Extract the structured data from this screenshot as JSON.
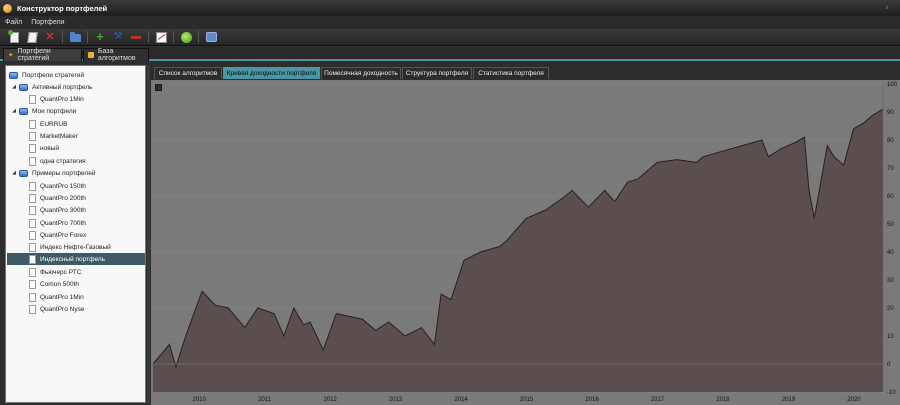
{
  "window": {
    "title": "Конструктор портфелей"
  },
  "menu": [
    "Файл",
    "Портфели"
  ],
  "toolbar_icons": [
    "new-document-icon",
    "edit-document-icon",
    "delete-icon",
    "open-folder-icon",
    "add-icon",
    "settings-icon",
    "remove-icon",
    "chart-icon",
    "refresh-icon",
    "database-icon"
  ],
  "doc_tabs": [
    {
      "label": "Портфели стратегий",
      "icon": "star-icon",
      "active": true
    },
    {
      "label": "База алгоритмов",
      "icon": "database-icon",
      "active": false
    }
  ],
  "tree": {
    "root": {
      "label": "Портфели стратегий"
    },
    "groups": [
      {
        "label": "Активный портфель",
        "items": [
          "QuantPro 1Min"
        ]
      },
      {
        "label": "Мои портфели",
        "items": [
          "EURRUB",
          "MarketMaker",
          "новый",
          "одна стратегия"
        ]
      },
      {
        "label": "Примеры портфелей",
        "items": [
          "QuantPro 150th",
          "QuantPro 200th",
          "QuantPro 300th",
          "QuantPro 700th",
          "QuantPro Forex",
          "Индекс Нефте-Газовый",
          "Индексный портфель",
          "Фьючерс РТС",
          "Comon 500th",
          "QuantPro 1Min",
          "QuantPro Nyse"
        ]
      }
    ],
    "selected": "Индексный портфель"
  },
  "sub_tabs": [
    {
      "label": "Список алгоритмов",
      "active": false
    },
    {
      "label": "Кривая доходности портфеля",
      "active": true
    },
    {
      "label": "Помесячная доходность",
      "active": false
    },
    {
      "label": "Структура портфеля",
      "active": false
    },
    {
      "label": "Статистика портфеля",
      "active": false
    }
  ],
  "colors": {
    "accent": "#4b96a6",
    "chart_background": "#7a7a7a",
    "area_fill": "#5a4e4e",
    "area_line": "#2a1e1e",
    "selection": "#405a65"
  },
  "chart_data": {
    "type": "area",
    "x": [
      2009.6,
      2009.85,
      2009.95,
      2010.1,
      2010.35,
      2010.55,
      2010.75,
      2011.0,
      2011.2,
      2011.45,
      2011.6,
      2011.75,
      2011.9,
      2012.0,
      2012.2,
      2012.4,
      2012.6,
      2012.8,
      2013.0,
      2013.2,
      2013.45,
      2013.7,
      2013.9,
      2014.0,
      2014.15,
      2014.35,
      2014.6,
      2014.9,
      2015.0,
      2015.3,
      2015.6,
      2015.9,
      2016.0,
      2016.25,
      2016.5,
      2016.65,
      2016.85,
      2017.0,
      2017.3,
      2017.6,
      2017.9,
      2018.0,
      2018.3,
      2018.6,
      2018.9,
      2019.0,
      2019.2,
      2019.4,
      2019.55,
      2019.62,
      2019.7,
      2019.9,
      2020.0,
      2020.15,
      2020.3,
      2020.45,
      2020.6,
      2020.75
    ],
    "values": [
      0,
      7,
      -1,
      10,
      26,
      21,
      20,
      13,
      20,
      18,
      10,
      20,
      14,
      15,
      5,
      18,
      17,
      16,
      12,
      15,
      10,
      13,
      7,
      25,
      23,
      37,
      40,
      42,
      44,
      52,
      55,
      60,
      62,
      56,
      62,
      58,
      65,
      66,
      72,
      73,
      72,
      74,
      76,
      78,
      80,
      74,
      77,
      79,
      81,
      62,
      52,
      78,
      74,
      71,
      84,
      86,
      89,
      91
    ],
    "xlim": [
      2009.6,
      2020.75
    ],
    "ylim": [
      -10,
      100
    ],
    "yticks": [
      100,
      90,
      80,
      70,
      60,
      50,
      40,
      30,
      20,
      10,
      0,
      -10
    ],
    "xtick_labels": [
      "2010",
      "2011",
      "2012",
      "2013",
      "2014",
      "2015",
      "2016",
      "2017",
      "2018",
      "2019",
      "2020"
    ],
    "xtick_values": [
      2010,
      2011,
      2012,
      2013,
      2014,
      2015,
      2016,
      2017,
      2018,
      2019,
      2020
    ],
    "grid": true,
    "legend": "top-left"
  }
}
